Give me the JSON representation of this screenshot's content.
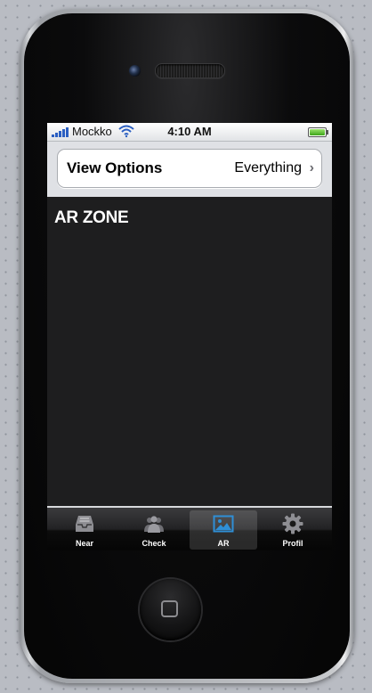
{
  "statusbar": {
    "carrier": "Mockko",
    "time": "4:10  AM",
    "signal_bars": 5,
    "battery_level": 1.0
  },
  "view_options": {
    "label": "View Options",
    "value": "Everything",
    "chevron_icon": "chevron-right-icon"
  },
  "content": {
    "title": "AR ZONE"
  },
  "tabbar": {
    "selected": "AR",
    "tabs": [
      {
        "label": "Near",
        "icon": "inbox-tray-icon"
      },
      {
        "label": "Check",
        "icon": "people-icon"
      },
      {
        "label": "AR",
        "icon": "picture-icon"
      },
      {
        "label": "Profil",
        "icon": "gear-icon"
      }
    ]
  },
  "colors": {
    "screen_background": "#1e1e1f",
    "tab_selected_icon": "#2f8fd6",
    "tab_icon": "#8e8e93",
    "signal": "#2b5fc2"
  }
}
